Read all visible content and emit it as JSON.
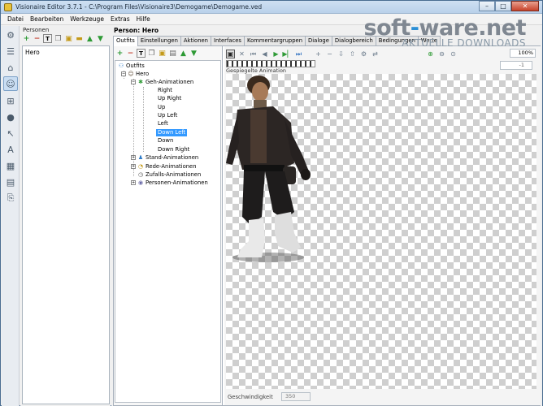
{
  "window": {
    "title": "Visionaire Editor 3.7.1 - C:\\Program Files\\Visionaire3\\Demogame\\Demogame.ved",
    "buttons": {
      "minimize": "–",
      "maximize": "□",
      "close": "✕"
    }
  },
  "menu": [
    "Datei",
    "Bearbeiten",
    "Werkzeuge",
    "Extras",
    "Hilfe"
  ],
  "persons_panel": {
    "label": "Personen",
    "items": [
      "Hero"
    ]
  },
  "person_header": "Person: Hero",
  "tabs": [
    "Outfits",
    "Einstellungen",
    "Aktionen",
    "Interfaces",
    "Kommentargruppen",
    "Dialoge",
    "Dialogbereich",
    "Bedingungen",
    "Werte"
  ],
  "active_tab": "Outfits",
  "tree": {
    "root": "Outfits",
    "outfit": "Hero",
    "walk_group": "Geh-Animationen",
    "walk_items": [
      "Right",
      "Up Right",
      "Up",
      "Up Left",
      "Left",
      "Down Left",
      "Down",
      "Down Right"
    ],
    "selected": "Down Left",
    "groups": [
      "Stand-Animationen",
      "Rede-Animationen",
      "Zufalls-Animationen",
      "Personen-Animationen"
    ]
  },
  "animation": {
    "name_label": "Gespiegelte Animation",
    "zoom": "100%",
    "frame_value": "-1",
    "speed_label": "Geschwindigkeit",
    "speed_value": "350"
  },
  "watermark": {
    "main_a": "soft",
    "main_dot": "-",
    "main_b": "ware.net",
    "sub": "AKTUELLE DOWNLOADS"
  },
  "icons": {
    "accent_blue": "#3399ff",
    "play_green": "#2e9a35"
  }
}
